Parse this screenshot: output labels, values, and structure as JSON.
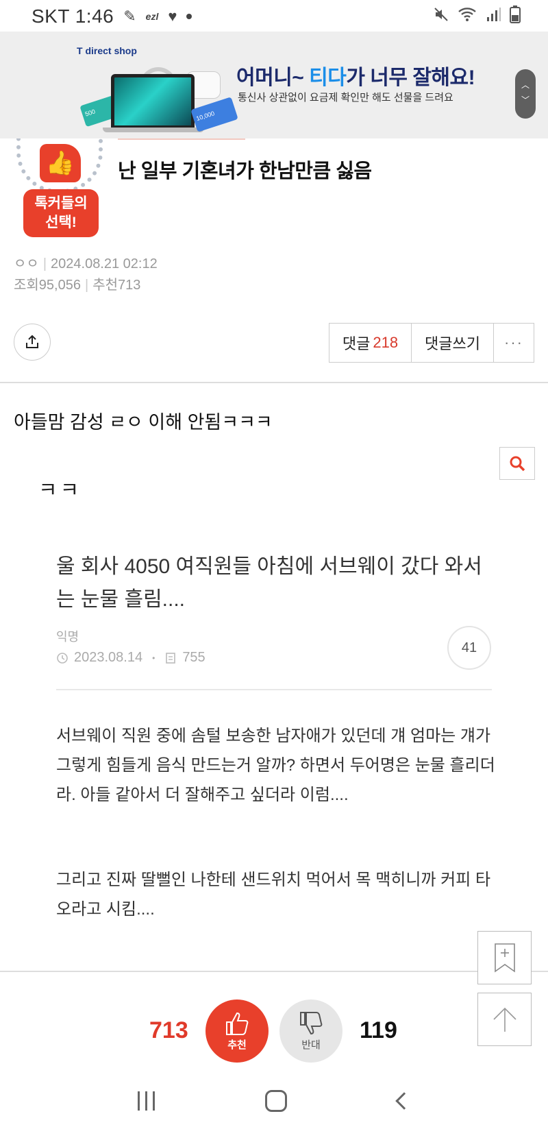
{
  "status_bar": {
    "carrier_time": "SKT 1:46",
    "ezl": "ezl"
  },
  "ad": {
    "brand": "T direct shop",
    "tag1": "500",
    "tag2": "10,000",
    "title_part1": "어머니~ ",
    "title_highlight": "티다",
    "title_part2": "가 너무 잘해요!",
    "subtitle": "통신사 상관없이 요금제 확인만 해도 선물을 드려요"
  },
  "badge": {
    "line1": "톡커들의",
    "line2": "선택!"
  },
  "post": {
    "title": "난 일부 기혼녀가 한남만큼 싫음",
    "author": "ㅇㅇ",
    "datetime": "2024.08.21 02:12",
    "views_label": "조회95,056",
    "recommend_label": "추천713",
    "body_text": "아들맘 감성 ㄹㅇ 이해 안됨ㅋㅋㅋ"
  },
  "actions": {
    "comment_label": "댓글",
    "comment_count": "218",
    "write_label": "댓글쓰기",
    "more_label": "···"
  },
  "embed": {
    "laugh": "ㅋㅋ",
    "title": "울 회사 4050 여직원들 아침에 서브웨이 갔다 와서는 눈물 흘림....",
    "author": "익명",
    "date": "2023.08.14",
    "views": "755",
    "comments": "41",
    "para1": "서브웨이 직원 중에 솜털 보송한 남자애가 있던데 걔 엄마는 걔가 그렇게 힘들게 음식 만드는거 알까? 하면서 두어명은 눈물 흘리더라. 아들 같아서 더 잘해주고 싶더라 이럼....",
    "para2": "그리고 진짜 딸뻘인 나한테 샌드위치 먹어서 목 맥히니까 커피 타오라고 시킴...."
  },
  "votes": {
    "up_count": "713",
    "up_label": "추천",
    "down_label": "반대",
    "down_count": "119"
  },
  "colors": {
    "accent": "#e8402b",
    "comment_count": "#d83a2c"
  }
}
